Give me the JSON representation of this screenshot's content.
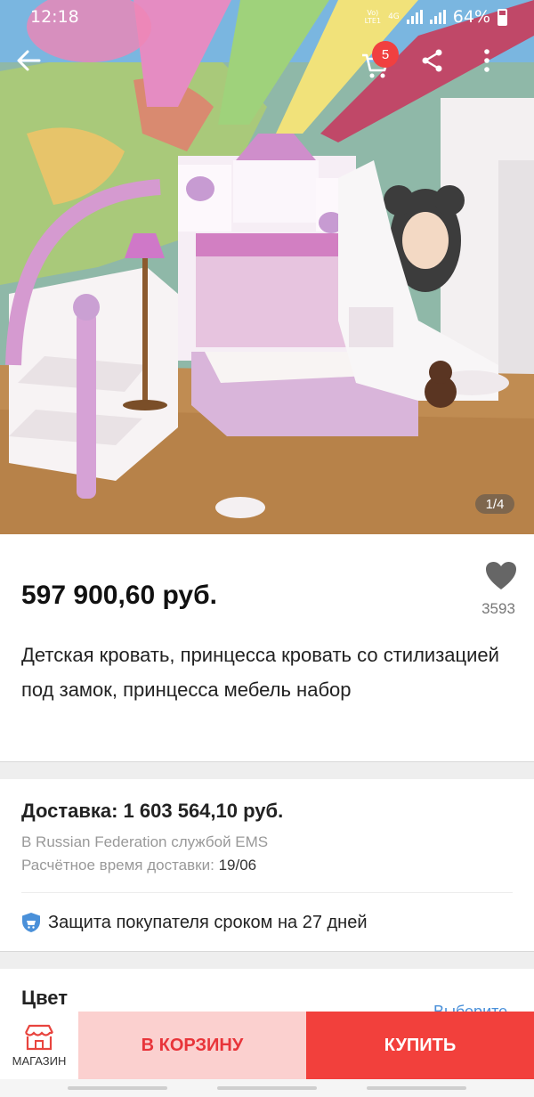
{
  "status_bar": {
    "time": "12:18",
    "network": [
      "Vo)",
      "LTE1",
      "4G"
    ],
    "battery": "64%"
  },
  "gallery": {
    "counter": "1/4"
  },
  "cart": {
    "badge_count": "5"
  },
  "product": {
    "price": "597 900,60 руб.",
    "wishlist_count": "3593",
    "title": "Детская кровать, принцесса кровать со стилизацией под замок, принцесса мебель набор"
  },
  "shipping": {
    "title": "Доставка: 1 603 564,10 руб.",
    "method": "В Russian Federation службой EMS",
    "eta_label": "Расчётное время доставки:",
    "eta_value": "19/06"
  },
  "protection": {
    "text": "Защита покупателя сроком на 27 дней"
  },
  "color": {
    "label": "Цвет",
    "choose": "Выберите"
  },
  "bottom_bar": {
    "store_label": "МАГАЗИН",
    "add_to_cart": "В КОРЗИНУ",
    "buy": "КУПИТЬ"
  },
  "colors": {
    "accent": "#f2403c",
    "add_to_cart_bg": "#fbd0cf",
    "link": "#4a90d9",
    "badge": "#f04040"
  }
}
